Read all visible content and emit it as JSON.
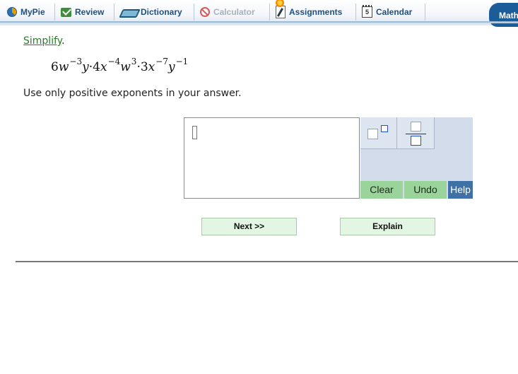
{
  "nav": {
    "tabs": [
      {
        "label": "MyPie",
        "icon": "pie-icon"
      },
      {
        "label": "Review",
        "icon": "checkmark-icon"
      },
      {
        "label": "Dictionary",
        "icon": "book-icon"
      },
      {
        "label": "Calculator",
        "icon": "no-entry-icon",
        "disabled": true
      },
      {
        "label": "Assignments",
        "icon": "assignment-icon"
      },
      {
        "label": "Calendar",
        "icon": "calendar-icon",
        "icon_text": "5"
      }
    ],
    "math_tab": "Math"
  },
  "question": {
    "instruction_link": "Simplify",
    "instruction_end": ".",
    "expression": {
      "t1_coef": "6",
      "t1_var": "w",
      "t1_exp": "−3",
      "t2_var": "y",
      "dot1": "·",
      "t3_coef": "4",
      "t3_var": "x",
      "t3_exp": "−4",
      "t4_var": "w",
      "t4_exp": "3",
      "dot2": "·",
      "t5_coef": "3",
      "t5_var": "x",
      "t5_exp": "−7",
      "t6_var": "y",
      "t6_exp": "−1"
    },
    "hint": "Use only positive exponents in your answer."
  },
  "answer": {
    "value": ""
  },
  "palette": {
    "clear_label": "Clear",
    "undo_label": "Undo",
    "help_label": "Help"
  },
  "buttons": {
    "next_label": "Next >>",
    "explain_label": "Explain"
  },
  "colors": {
    "nav_text": "#1d4f82",
    "link_green": "#2d7a2d",
    "tool_green": "#9bd49b",
    "help_blue": "#3f70a6",
    "palette_bg": "#d2dceb"
  }
}
